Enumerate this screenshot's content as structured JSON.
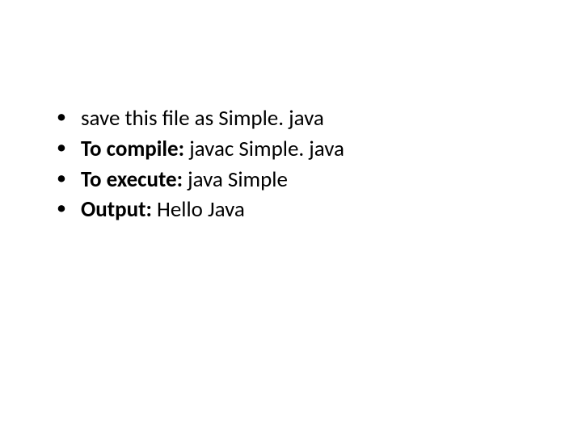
{
  "bullets": [
    {
      "prefix": "",
      "label": "",
      "text": "save this file as Simple. java"
    },
    {
      "prefix": "",
      "label": "To compile:",
      "text": " javac Simple. java"
    },
    {
      "prefix": "",
      "label": "To execute:",
      "text": " java Simple"
    },
    {
      "prefix": "",
      "label": "Output:",
      "text": " Hello Java"
    }
  ]
}
